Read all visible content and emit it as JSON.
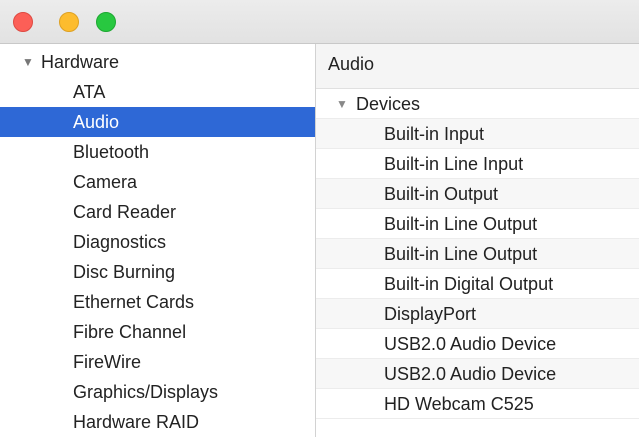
{
  "titlebar": {
    "controls": [
      "close-button",
      "minimize-button",
      "zoom-button"
    ],
    "colors": {
      "close": "#fc5f57",
      "minimize": "#fdbc2e",
      "zoom": "#28c840"
    }
  },
  "sidebar": {
    "group_label": "Hardware",
    "group_icon": "disclosure-triangle-expanded",
    "selected_color": "#2e68d6",
    "items": [
      {
        "label": "ATA"
      },
      {
        "label": "Audio",
        "selected": true
      },
      {
        "label": "Bluetooth"
      },
      {
        "label": "Camera"
      },
      {
        "label": "Card Reader"
      },
      {
        "label": "Diagnostics"
      },
      {
        "label": "Disc Burning"
      },
      {
        "label": "Ethernet Cards"
      },
      {
        "label": "Fibre Channel"
      },
      {
        "label": "FireWire"
      },
      {
        "label": "Graphics/Displays"
      },
      {
        "label": "Hardware RAID"
      }
    ]
  },
  "detail": {
    "title": "Audio",
    "group_label": "Devices",
    "group_icon": "disclosure-triangle-expanded",
    "items": [
      {
        "label": "Built-in Input"
      },
      {
        "label": "Built-in Line Input"
      },
      {
        "label": "Built-in Output"
      },
      {
        "label": "Built-in Line Output"
      },
      {
        "label": "Built-in Line Output"
      },
      {
        "label": "Built-in Digital Output"
      },
      {
        "label": "DisplayPort"
      },
      {
        "label": "USB2.0 Audio Device"
      },
      {
        "label": "USB2.0 Audio Device"
      },
      {
        "label": "HD Webcam C525"
      }
    ]
  }
}
